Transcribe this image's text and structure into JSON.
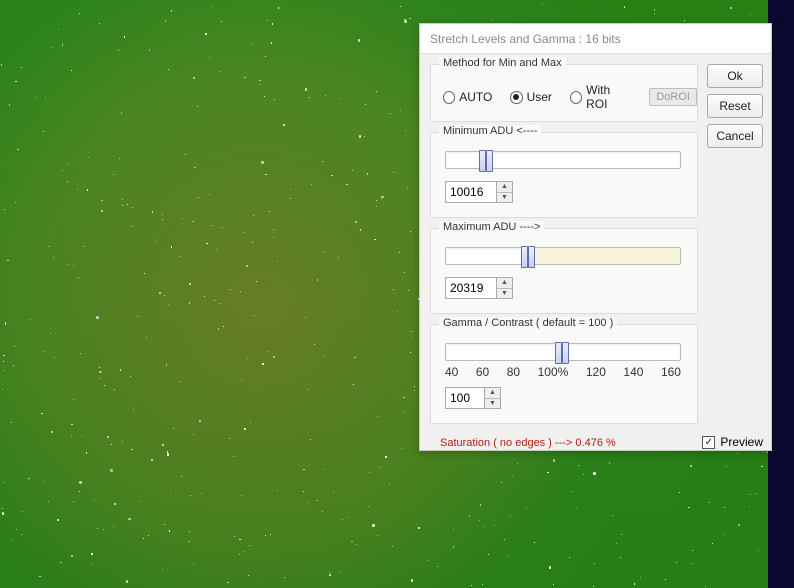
{
  "title": "Stretch Levels and Gamma :   16 bits",
  "group_method": {
    "label": "Method for Min and Max",
    "auto": "AUTO",
    "user": "User",
    "withroi": "With ROI",
    "doroi": "DoROI",
    "selected": "user"
  },
  "min_adu": {
    "label": "Minimum  ADU    <----",
    "value": "10016",
    "pos_pct": 14
  },
  "max_adu": {
    "label": "Maximum  ADU    ---->",
    "value": "20319",
    "pos_pct": 32
  },
  "gamma": {
    "label": "Gamma / Contrast   ( default = 100 )",
    "value": "100",
    "pos_pct": 50,
    "ticks": [
      "40",
      "60",
      "80",
      "100%",
      "120",
      "140",
      "160"
    ]
  },
  "saturation": "Saturation ( no edges )  --->   0.476 %",
  "buttons": {
    "ok": "Ok",
    "reset": "Reset",
    "cancel": "Cancel"
  },
  "preview": {
    "label": "Preview",
    "checked": true
  }
}
